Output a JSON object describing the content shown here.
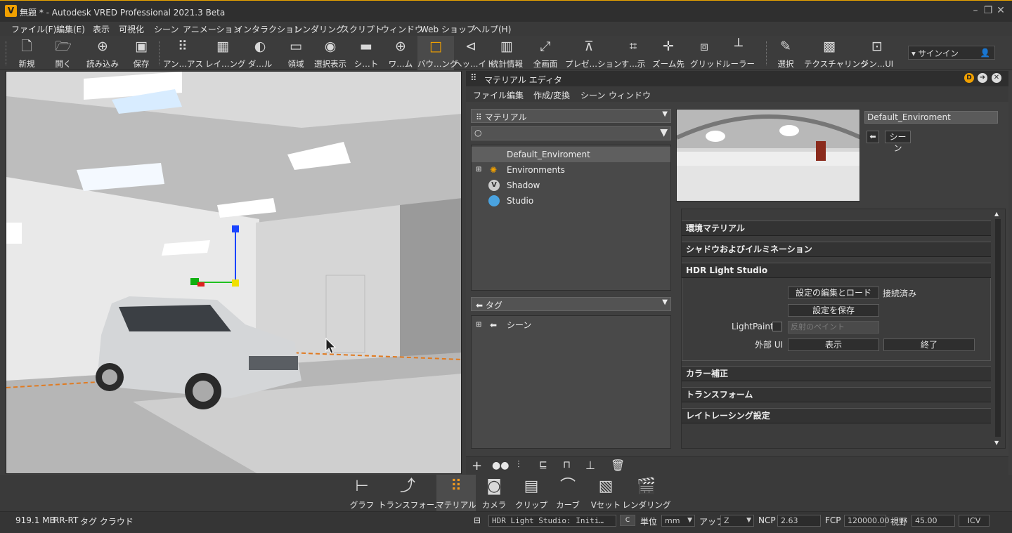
{
  "window": {
    "title": "無題 * - Autodesk VRED Professional 2021.3 Beta",
    "logo": "V"
  },
  "menu": [
    "ファイル(F)",
    "編集(E)",
    "表示",
    "可視化",
    "シーン",
    "アニメーション",
    "インタラクション",
    "レンダリング",
    "スクリプト",
    "ウィンドウ",
    "Web ショップ",
    "ヘルプ(H)"
  ],
  "toolbar": [
    "新規",
    "開く",
    "読み込み",
    "保存",
    "アン…アス",
    "レイ…ング",
    "ダ…ル",
    "領域",
    "選択表示",
    "シ…ト",
    "ワ…ム",
    "バウ…ング",
    "ヘッ…イト",
    "統計情報",
    "全画面",
    "プレゼ…ション",
    "す…示",
    "ズーム先",
    "グリッド",
    "ルーラー",
    "選択",
    "テクスチャリング",
    "シン…UI"
  ],
  "signin": "サインイン",
  "material_editor": {
    "title": "マテリアル エディタ",
    "menu": [
      "ファイル",
      "編集",
      "作成/変換",
      "シーン",
      "ウィンドウ"
    ],
    "material_dropdown": "マテリアル",
    "materials": [
      "Default_Enviroment",
      "Environments",
      "Shadow",
      "Studio"
    ],
    "tag_dropdown": "タグ",
    "tags": [
      "シーン"
    ],
    "selected_name": "Default_Enviroment",
    "scene_button": "シーン",
    "sections": [
      "環境マテリアル",
      "シャドウおよびイルミネーション",
      "HDR Light Studio",
      "カラー補正",
      "トランスフォーム",
      "レイトレーシング設定"
    ],
    "hdr": {
      "edit_load": "設定の編集とロード",
      "status": "接続済み",
      "save": "設定を保存",
      "lightpaint_label": "LightPaint",
      "lightpaint_value": "反射のペイント",
      "external_label": "外部 UI",
      "show": "表示",
      "quit": "終了"
    }
  },
  "bottom_tabs": [
    "グラフ",
    "トランスフォーム",
    "マテリアル",
    "カメラ",
    "クリップ",
    "カーブ",
    "Vセット",
    "レンダリング"
  ],
  "status": {
    "memory": "919.1 MB",
    "mode": "RR-RT",
    "tagcloud": "タグ クラウド",
    "console": "HDR Light Studio: Initi…",
    "unit_label": "単位",
    "unit": "mm",
    "up_label": "アップ",
    "up": "Z",
    "ncp_label": "NCP",
    "ncp": "2.63",
    "fcp_label": "FCP",
    "fcp": "120000.00",
    "fov_label": "視野",
    "fov": "45.00",
    "icv": "ICV"
  },
  "colors": {
    "accent": "#f0a000",
    "selected_tab": "#f29a1e"
  }
}
